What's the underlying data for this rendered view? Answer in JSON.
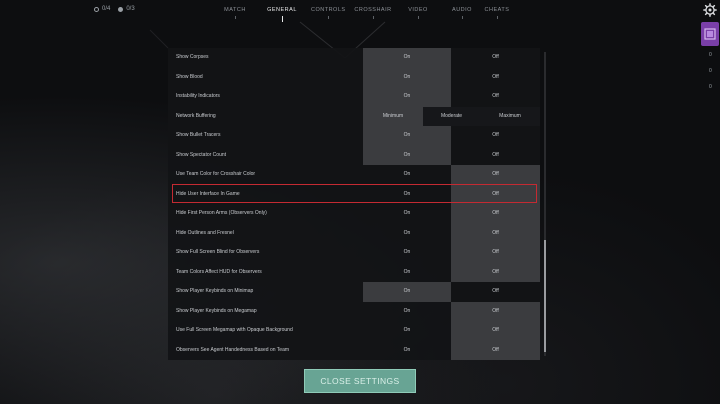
{
  "counters": {
    "first": "0/4",
    "second": "0/3"
  },
  "tabs": [
    {
      "label": "MATCH",
      "active": false
    },
    {
      "label": "GENERAL",
      "active": true
    },
    {
      "label": "CONTROLS",
      "active": false
    },
    {
      "label": "CROSSHAIR",
      "active": false
    },
    {
      "label": "VIDEO",
      "active": false
    },
    {
      "label": "AUDIO",
      "active": false
    },
    {
      "label": "CHEATS",
      "active": false
    }
  ],
  "icons": {
    "gear": "gear-icon",
    "counter_ring": "ring-icon",
    "counter_dot": "dot-icon",
    "rail_badge": "friends-icon"
  },
  "rail": {
    "numbers": [
      "0",
      "0",
      "0"
    ]
  },
  "settings": {
    "rows": [
      {
        "label": "Show Corpses",
        "type": "toggle",
        "on": "On",
        "off": "Off",
        "selected": "on"
      },
      {
        "label": "Show Blood",
        "type": "toggle",
        "on": "On",
        "off": "Off",
        "selected": "on"
      },
      {
        "label": "Instability Indicators",
        "type": "toggle",
        "on": "On",
        "off": "Off",
        "selected": "on"
      },
      {
        "label": "Network Buffering",
        "type": "triple",
        "options": [
          "Minimum",
          "Moderate",
          "Maximum"
        ],
        "selected": 0
      },
      {
        "label": "Show Bullet Tracers",
        "type": "toggle",
        "on": "On",
        "off": "Off",
        "selected": "on"
      },
      {
        "label": "Show Spectator Count",
        "type": "toggle",
        "on": "On",
        "off": "Off",
        "selected": "on"
      },
      {
        "label": "Use Team Color for Crosshair Color",
        "type": "toggle",
        "on": "On",
        "off": "Off",
        "selected": "off"
      },
      {
        "label": "Hide User Interface In Game",
        "type": "toggle",
        "on": "On",
        "off": "Off",
        "selected": "off",
        "highlighted": true
      },
      {
        "label": "Hide First Person Arms (Observers Only)",
        "type": "toggle",
        "on": "On",
        "off": "Off",
        "selected": "off"
      },
      {
        "label": "Hide Outlines and Fresnel",
        "type": "toggle",
        "on": "On",
        "off": "Off",
        "selected": "off"
      },
      {
        "label": "Show Full Screen Blind for Observers",
        "type": "toggle",
        "on": "On",
        "off": "Off",
        "selected": "off"
      },
      {
        "label": "Team Colors Affect HUD for Observers",
        "type": "toggle",
        "on": "On",
        "off": "Off",
        "selected": "off"
      },
      {
        "label": "Show Player Keybinds on Minimap",
        "type": "toggle",
        "on": "On",
        "off": "Off",
        "selected": "on"
      },
      {
        "label": "Show Player Keybinds on Megamap",
        "type": "toggle",
        "on": "On",
        "off": "Off",
        "selected": "off"
      },
      {
        "label": "Use Full Screen Megamap with Opaque Background",
        "type": "toggle",
        "on": "On",
        "off": "Off",
        "selected": "off"
      },
      {
        "label": "Observers See Agent Handedness Based on Team",
        "type": "toggle",
        "on": "On",
        "off": "Off",
        "selected": "off"
      }
    ]
  },
  "close_button": {
    "label": "CLOSE SETTINGS"
  },
  "colors": {
    "highlight": "#c42a32",
    "close_button": "#68a494",
    "selected_cell": "#3b3c3f",
    "rail_badge": "#7a3fa8"
  }
}
